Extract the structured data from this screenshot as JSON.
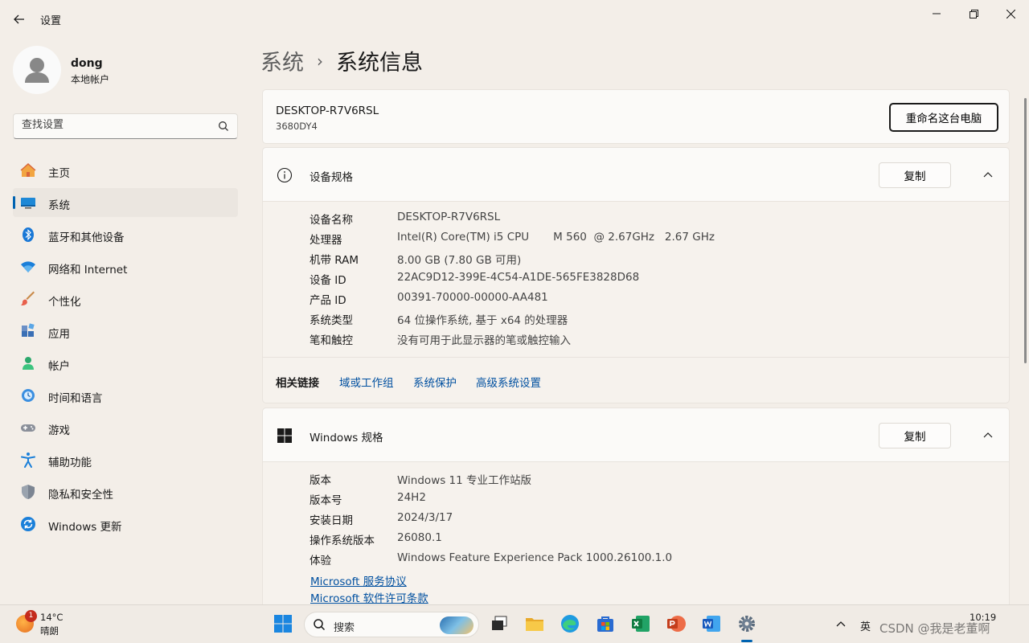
{
  "window": {
    "title": "设置"
  },
  "user": {
    "name": "dong",
    "type": "本地帐户"
  },
  "search": {
    "placeholder": "查找设置"
  },
  "nav": [
    {
      "label": "主页",
      "icon": "home-icon"
    },
    {
      "label": "系统",
      "icon": "system-icon",
      "active": true
    },
    {
      "label": "蓝牙和其他设备",
      "icon": "bluetooth-icon"
    },
    {
      "label": "网络和 Internet",
      "icon": "wifi-icon"
    },
    {
      "label": "个性化",
      "icon": "brush-icon"
    },
    {
      "label": "应用",
      "icon": "apps-icon"
    },
    {
      "label": "帐户",
      "icon": "account-icon"
    },
    {
      "label": "时间和语言",
      "icon": "clock-globe-icon"
    },
    {
      "label": "游戏",
      "icon": "gamepad-icon"
    },
    {
      "label": "辅助功能",
      "icon": "accessibility-icon"
    },
    {
      "label": "隐私和安全性",
      "icon": "shield-icon"
    },
    {
      "label": "Windows 更新",
      "icon": "update-icon"
    }
  ],
  "breadcrumb": {
    "parent": "系统",
    "separator": "›",
    "current": "系统信息"
  },
  "pc": {
    "name": "DESKTOP-R7V6RSL",
    "model": "3680DY4",
    "rename_label": "重命名这台电脑"
  },
  "device_specs": {
    "title": "设备规格",
    "copy_label": "复制",
    "rows": [
      {
        "key": "设备名称",
        "value": "DESKTOP-R7V6RSL"
      },
      {
        "key": "处理器",
        "value": "Intel(R) Core(TM) i5 CPU       M 560  @ 2.67GHz   2.67 GHz"
      },
      {
        "key": "机带 RAM",
        "value": "8.00 GB (7.80 GB 可用)"
      },
      {
        "key": "设备 ID",
        "value": "22AC9D12-399E-4C54-A1DE-565FE3828D68"
      },
      {
        "key": "产品 ID",
        "value": "00391-70000-00000-AA481"
      },
      {
        "key": "系统类型",
        "value": "64 位操作系统, 基于 x64 的处理器"
      },
      {
        "key": "笔和触控",
        "value": "没有可用于此显示器的笔或触控输入"
      }
    ]
  },
  "related": {
    "title": "相关链接",
    "links": [
      "域或工作组",
      "系统保护",
      "高级系统设置"
    ]
  },
  "windows_specs": {
    "title": "Windows 规格",
    "copy_label": "复制",
    "rows": [
      {
        "key": "版本",
        "value": "Windows 11 专业工作站版"
      },
      {
        "key": "版本号",
        "value": "24H2"
      },
      {
        "key": "安装日期",
        "value": "2024/3/17"
      },
      {
        "key": "操作系统版本",
        "value": "26080.1"
      },
      {
        "key": "体验",
        "value": "Windows Feature Experience Pack 1000.26100.1.0"
      }
    ],
    "links": [
      "Microsoft 服务协议",
      "Microsoft 软件许可条款"
    ]
  },
  "taskbar": {
    "weather_temp": "14°C",
    "weather_condition": "晴朗",
    "weather_badge": "1",
    "search_label": "搜索",
    "ime": "英",
    "time": "10:19",
    "watermark": "CSDN @我是老董啊"
  },
  "colors": {
    "accent": "#0063b1",
    "link": "#0050a0",
    "background": "#f3eee8"
  }
}
